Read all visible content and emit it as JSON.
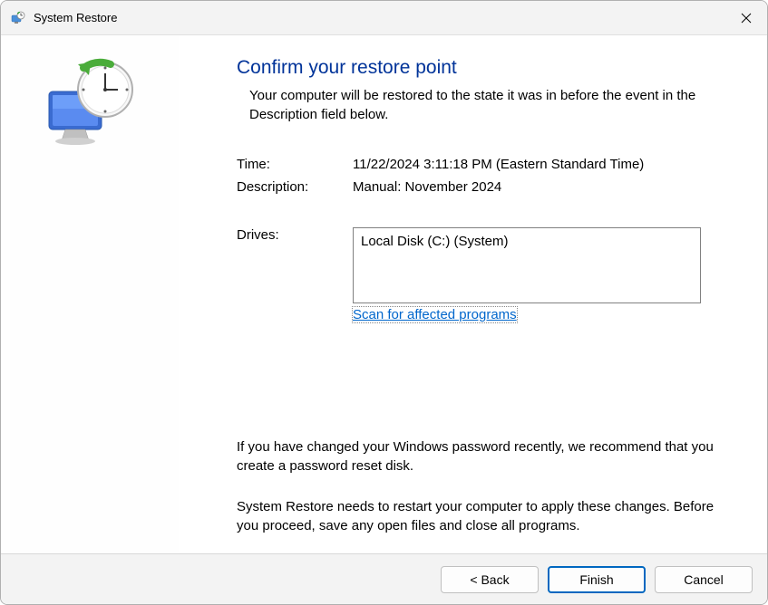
{
  "titlebar": {
    "title": "System Restore"
  },
  "main": {
    "heading": "Confirm your restore point",
    "subheading": "Your computer will be restored to the state it was in before the event in the Description field below.",
    "time_label": "Time:",
    "time_value": "11/22/2024 3:11:18 PM (Eastern Standard Time)",
    "description_label": "Description:",
    "description_value": "Manual: November 2024",
    "drives_label": "Drives:",
    "drives_value": "Local Disk (C:) (System)",
    "scan_link": "Scan for affected programs",
    "password_warning": "If you have changed your Windows password recently, we recommend that you create a password reset disk.",
    "restart_warning": "System Restore needs to restart your computer to apply these changes. Before you proceed, save any open files and close all programs."
  },
  "footer": {
    "back": "< Back",
    "finish": "Finish",
    "cancel": "Cancel"
  }
}
